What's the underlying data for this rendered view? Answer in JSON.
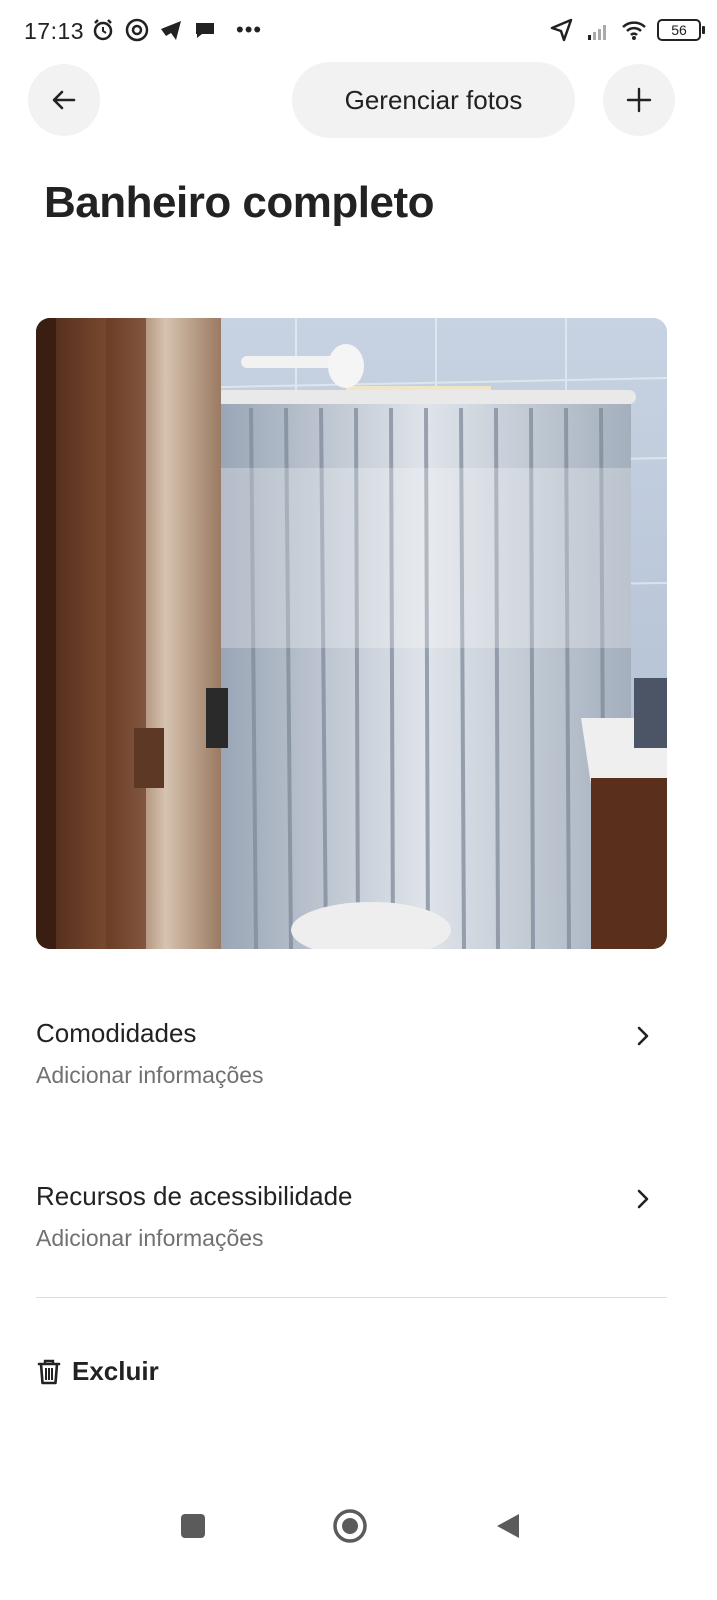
{
  "status_bar": {
    "time": "17:13",
    "battery": "56"
  },
  "header": {
    "manage_photos_label": "Gerenciar fotos"
  },
  "page": {
    "title": "Banheiro completo"
  },
  "photo": {
    "description_icon": "bathroom-photo"
  },
  "sections": [
    {
      "title": "Comodidades",
      "subtitle": "Adicionar informações"
    },
    {
      "title": "Recursos de acessibilidade",
      "subtitle": "Adicionar informações"
    }
  ],
  "actions": {
    "delete_label": "Excluir"
  },
  "colors": {
    "text": "#222222",
    "secondary_text": "#717171",
    "button_bg": "#f2f2f2",
    "divider": "#dddddd"
  }
}
